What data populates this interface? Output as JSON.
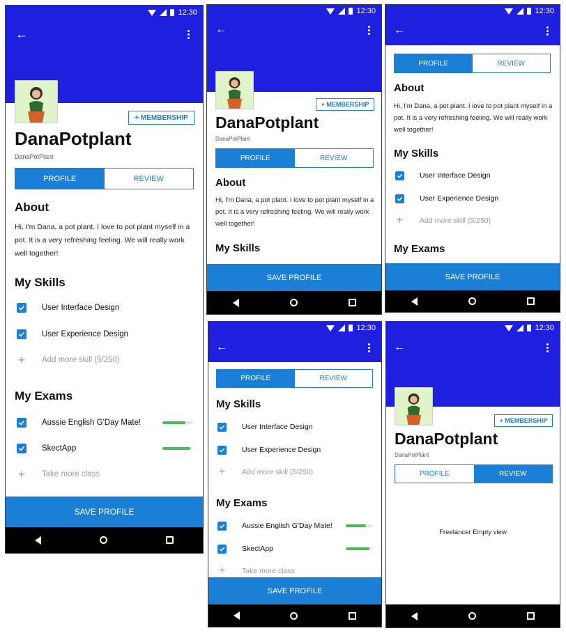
{
  "status": {
    "time": "12:30"
  },
  "profile": {
    "name": "DanaPotplant",
    "handle": "DanaPotPlant",
    "membership_label": "+ MEMBERSHIP"
  },
  "tabs": {
    "profile": "PROFILE",
    "review": "REVIEW"
  },
  "about": {
    "heading": "About",
    "text": "Hi, I'm Dana, a pot plant. I love to pot plant myself in a pot. It is a very refreshing feeling. We will really work well together!"
  },
  "skills": {
    "heading": "My Skills",
    "items": [
      "User Interface Design",
      "User Experience Design"
    ],
    "add_label": "Add more skill (5/250)"
  },
  "exams": {
    "heading": "My Exams",
    "items": [
      {
        "label": "Aussie English G'Day Mate!",
        "progress": 0.75
      },
      {
        "label": "SkectApp",
        "progress": 0.9
      }
    ],
    "add_label": "Take more class"
  },
  "save_label": "SAVE PROFILE",
  "review_empty": "Freelancer Empty view",
  "colors": {
    "primary_dark": "#1f1fe0",
    "accent": "#1b7fd6",
    "progress": "#4cbb5a"
  },
  "icons": [
    "back-arrow-icon",
    "more-vert-icon",
    "checkbox-checked-icon",
    "plus-icon",
    "nav-back-icon",
    "nav-home-icon",
    "nav-recent-icon",
    "wifi-icon",
    "signal-icon",
    "battery-icon"
  ]
}
